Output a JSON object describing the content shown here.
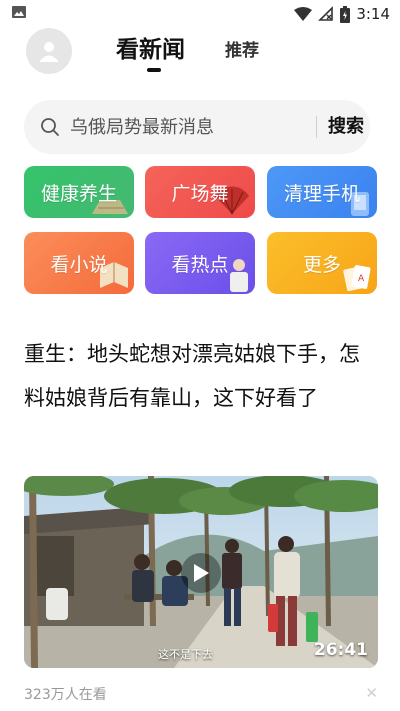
{
  "status_bar": {
    "time": "3:14",
    "icons": [
      "image-icon",
      "wifi-icon",
      "signal-off-icon",
      "battery-icon"
    ]
  },
  "header": {
    "tabs": [
      {
        "label": "看新闻",
        "active": true
      },
      {
        "label": "推荐",
        "active": false
      }
    ]
  },
  "search": {
    "placeholder": "乌俄局势最新消息",
    "button_label": "搜索"
  },
  "tiles": [
    {
      "label": "健康养生",
      "color": "#3dbf6a",
      "icon": "fan-icon"
    },
    {
      "label": "广场舞",
      "color": "#f0524e",
      "icon": "fan-icon"
    },
    {
      "label": "清理手机",
      "color": "#3f8df5",
      "icon": "phone-icon"
    },
    {
      "label": "看小说",
      "color": "#f87a4a",
      "icon": "book-icon"
    },
    {
      "label": "看热点",
      "color": "#7b5ef0",
      "icon": "person-icon"
    },
    {
      "label": "更多",
      "color": "#f9b11a",
      "icon": "cards-icon"
    }
  ],
  "article": {
    "headline": "重生：地头蛇想对漂亮姑娘下手，怎料姑娘背后有靠山，这下好看了",
    "video_duration": "26:41",
    "video_subtitle": "这不是下去",
    "viewers": "323万人在看"
  }
}
